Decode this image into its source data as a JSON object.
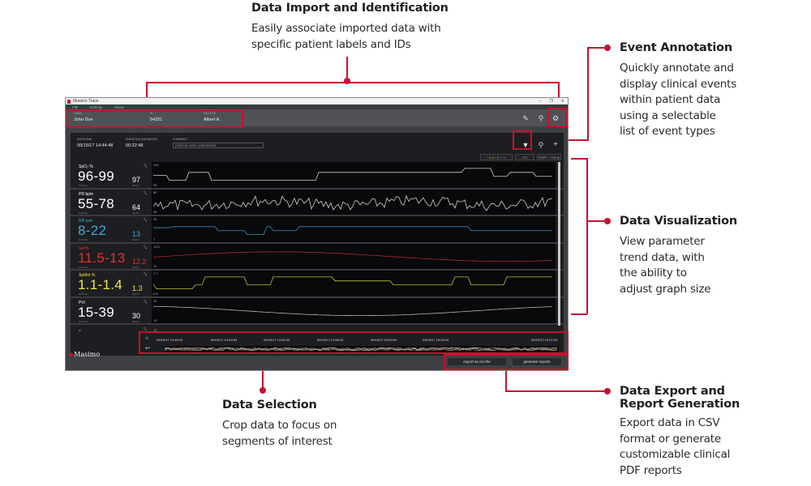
{
  "callouts": {
    "data_import": {
      "title": "Data Import and Identification",
      "body": [
        "Easily associate imported data with",
        "specific patient labels and IDs"
      ]
    },
    "event_annotation": {
      "title": "Event Annotation",
      "body": [
        "Quickly annotate and",
        "display clinical events",
        "within patient data",
        "using a selectable",
        "list of event types"
      ]
    },
    "data_visualization": {
      "title": "Data Visualization",
      "body": [
        "View parameter",
        "trend data, with",
        "the ability to",
        "adjust graph size"
      ]
    },
    "data_selection": {
      "title": "Data Selection",
      "body": [
        "Crop data to focus on",
        "segments of interest"
      ]
    },
    "data_export": {
      "title": [
        "Data Export and",
        "Report Generation"
      ],
      "body": [
        "Export data in CSV",
        "format or generate",
        "customizable clinical",
        "PDF reports"
      ]
    }
  },
  "app": {
    "title": "Masimo Trace",
    "window_controls": [
      "–",
      "❐",
      "✕"
    ],
    "menu": [
      "File",
      "Settings",
      "About"
    ],
    "patient": {
      "label_title": "LABEL",
      "label_value": "John Doe",
      "id_title": "ID",
      "id_value": "54321",
      "doctor_title": "DOCTOR",
      "doctor_value": "Albert A."
    },
    "toolbar_icons": [
      "pencil-icon",
      "search-icon",
      "user-settings-icon"
    ],
    "session": {
      "datetime_title": "DATE/TIME",
      "datetime_value": "09/15/17 14:44:48",
      "duration_title": "DURATION (HH:MM:SS)",
      "duration_value": "00:22:48",
      "comment_title": "COMMENT",
      "comment_placeholder": "(click to enter comments)"
    },
    "view_tabs": [
      "rainbow",
      "O3",
      "NIBP + Temp"
    ],
    "range_label": "RANGE",
    "mean_label": "MEAN",
    "parameters": [
      {
        "name": "SpO₂ %",
        "range": "96-99",
        "mean": "97",
        "ymax": "100",
        "ymin": "95",
        "color": "#ffffff",
        "line": "#d0d0d0"
      },
      {
        "name": "PR bpm",
        "range": "55-78",
        "mean": "64",
        "ymax": "80",
        "ymin": "55",
        "color": "#ffffff",
        "line": "#d0d0d0"
      },
      {
        "name": "RR rpm",
        "range": "8-22",
        "mean": "13",
        "ymax": "25",
        "ymin": "7",
        "color": "#3fa9d6",
        "line": "#3a8fb8"
      },
      {
        "name": "SpHb",
        "range": "11.5-13",
        "mean": "12.2",
        "ymax": "13.5",
        "ymin": "11",
        "color": "#e03030",
        "line": "#b02a2a"
      },
      {
        "name": "SpMet %",
        "range": "1.1-1.4",
        "mean": "1.3",
        "ymax": "1.7",
        "ymin": "0.8",
        "color": "#f2e53c",
        "line": "#c8c040"
      },
      {
        "name": "PVi",
        "range": "15-39",
        "mean": "30",
        "ymax": "40",
        "ymin": "10",
        "color": "#ffffff",
        "line": "#b8b8b8"
      }
    ],
    "last_row": {
      "name": "••",
      "ymax": "12"
    },
    "timeline_ticks": [
      "09/15/17 14:45:24",
      "09/15/17 14:49:04",
      "09/15/17 14:52:44",
      "09/15/17 14:56:24",
      "09/15/17 15:00:04",
      "09/15/17 15:03:44",
      "09/15/17 15:07:24"
    ],
    "buttons": {
      "export": "export as csv file",
      "report": "generate reports"
    },
    "logo": "Masimo"
  }
}
